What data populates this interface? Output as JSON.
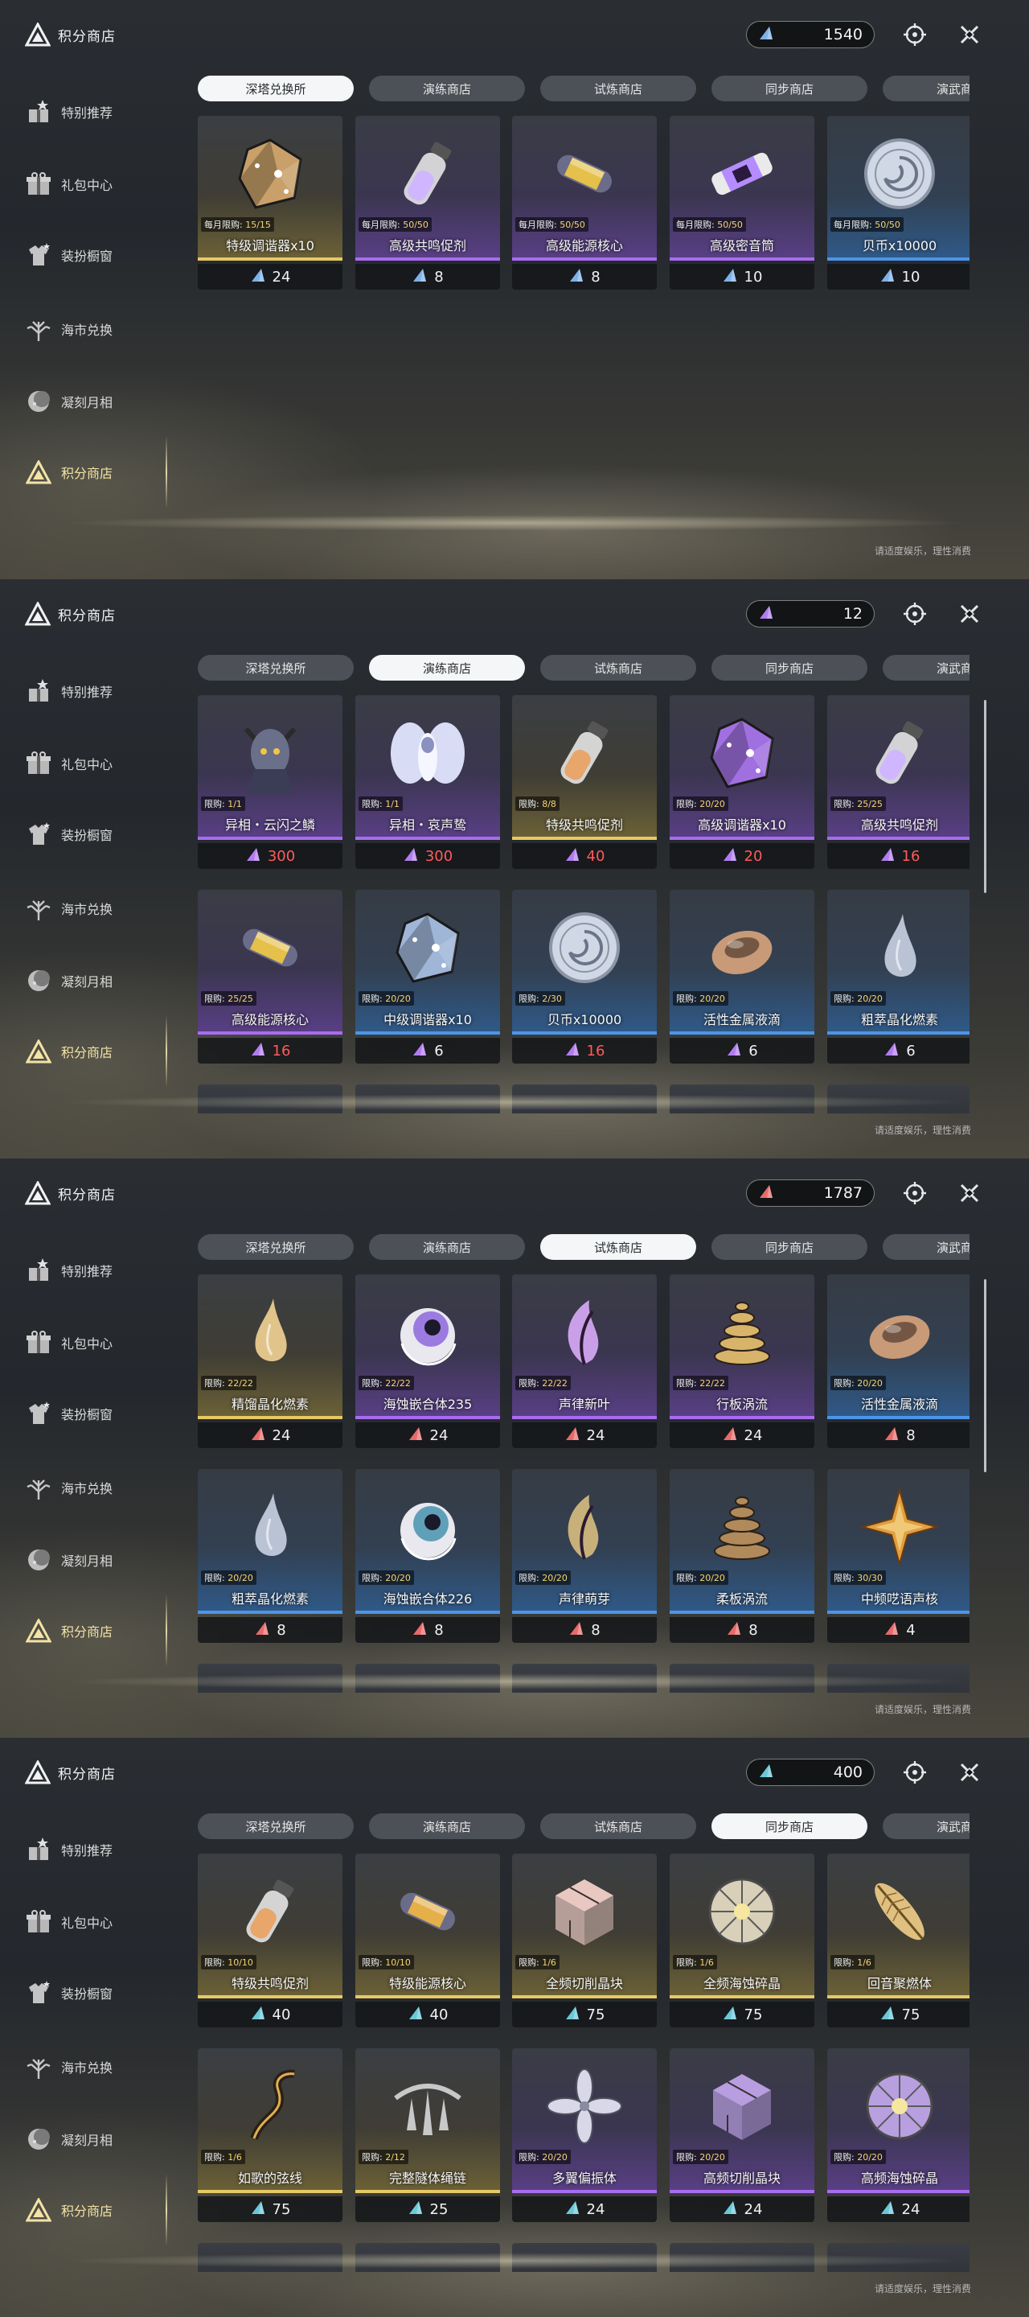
{
  "brand": {
    "title": "积分商店"
  },
  "sidebar": [
    {
      "label": "特别推荐",
      "icon": "gift-star-icon"
    },
    {
      "label": "礼包中心",
      "icon": "gift-box-icon"
    },
    {
      "label": "装扮橱窗",
      "icon": "wardrobe-icon"
    },
    {
      "label": "海市兑换",
      "icon": "tree-icon"
    },
    {
      "label": "凝刻月相",
      "icon": "moon-icon"
    },
    {
      "label": "积分商店",
      "icon": "triangle-shop-icon"
    }
  ],
  "tabs": [
    "深塔兑换所",
    "演练商店",
    "试炼商店",
    "同步商店",
    "演武商店"
  ],
  "notice": "请适度娱乐，理性消费",
  "colors": {
    "gold": "#e6c866",
    "purple": "#a86cf0",
    "blue": "#4c95e8",
    "price_red": "#ff5b5b"
  },
  "screens": [
    {
      "active_tab": 0,
      "currency": {
        "amount": "1540",
        "color": "#7fb0e8"
      },
      "scroll": false,
      "items": [
        {
          "name": "特级调谐器x10",
          "limit_label": "每月限购:",
          "limit": "15/15",
          "price": "24",
          "rarity": "gold",
          "art": "gem",
          "art_color": "#c9a06a"
        },
        {
          "name": "高级共鸣促剂",
          "limit_label": "每月限购:",
          "limit": "50/50",
          "price": "8",
          "rarity": "purple",
          "art": "vial",
          "art_color": "#d0b6ff"
        },
        {
          "name": "高级能源核心",
          "limit_label": "每月限购:",
          "limit": "50/50",
          "price": "8",
          "rarity": "purple",
          "art": "capsule",
          "art_color": "#e5c04a"
        },
        {
          "name": "高级密音筒",
          "limit_label": "每月限购:",
          "limit": "50/50",
          "price": "10",
          "rarity": "purple",
          "art": "cylinder",
          "art_color": "#b58cff"
        },
        {
          "name": "贝币x10000",
          "limit_label": "每月限购:",
          "limit": "50/50",
          "price": "10",
          "rarity": "blue",
          "art": "coin",
          "art_color": "#cfd8e4"
        }
      ]
    },
    {
      "active_tab": 1,
      "currency": {
        "amount": "12",
        "color": "#b27cf0"
      },
      "scroll": true,
      "items": [
        {
          "name": "异相・云闪之鳞",
          "limit_label": "限购:",
          "limit": "1/1",
          "price": "300",
          "rarity": "purple",
          "art": "figure",
          "art_color": "#6a6f8a",
          "red": true
        },
        {
          "name": "异相・哀声鸷",
          "limit_label": "限购:",
          "limit": "1/1",
          "price": "300",
          "rarity": "purple",
          "art": "wings",
          "art_color": "#d8dcf5",
          "red": true
        },
        {
          "name": "特级共鸣促剂",
          "limit_label": "限购:",
          "limit": "8/8",
          "price": "40",
          "rarity": "gold",
          "art": "vial",
          "art_color": "#e8a66a",
          "red": true
        },
        {
          "name": "高级调谐器x10",
          "limit_label": "限购:",
          "limit": "20/20",
          "price": "20",
          "rarity": "purple",
          "art": "gem",
          "art_color": "#a070e0",
          "red": true
        },
        {
          "name": "高级共鸣促剂",
          "limit_label": "限购:",
          "limit": "25/25",
          "price": "16",
          "rarity": "purple",
          "art": "vial",
          "art_color": "#d0b6ff",
          "red": true
        },
        {
          "name": "高级能源核心",
          "limit_label": "限购:",
          "limit": "25/25",
          "price": "16",
          "rarity": "purple",
          "art": "capsule",
          "art_color": "#e5c04a",
          "red": true
        },
        {
          "name": "中级调谐器x10",
          "limit_label": "限购:",
          "limit": "20/20",
          "price": "6",
          "rarity": "blue",
          "art": "gem",
          "art_color": "#9fb6d8"
        },
        {
          "name": "贝币x10000",
          "limit_label": "限购:",
          "limit": "2/30",
          "price": "16",
          "rarity": "blue",
          "art": "coin",
          "art_color": "#cfd8e4",
          "red": true
        },
        {
          "name": "活性金属液滴",
          "limit_label": "限购:",
          "limit": "20/20",
          "price": "6",
          "rarity": "blue",
          "art": "shell",
          "art_color": "#c89a78"
        },
        {
          "name": "粗萃晶化燃素",
          "limit_label": "限购:",
          "limit": "20/20",
          "price": "6",
          "rarity": "blue",
          "art": "drop",
          "art_color": "#b9c3d4"
        }
      ]
    },
    {
      "active_tab": 2,
      "currency": {
        "amount": "1787",
        "color": "#e86a6a"
      },
      "scroll": true,
      "items": [
        {
          "name": "精馏晶化燃素",
          "limit_label": "限购:",
          "limit": "22/22",
          "price": "24",
          "rarity": "gold",
          "art": "drop",
          "art_color": "#e0c48a"
        },
        {
          "name": "海蚀嵌合体235",
          "limit_label": "限购:",
          "limit": "22/22",
          "price": "24",
          "rarity": "purple",
          "art": "orb",
          "art_color": "#9b7be0"
        },
        {
          "name": "声律新叶",
          "limit_label": "限购:",
          "limit": "22/22",
          "price": "24",
          "rarity": "purple",
          "art": "leaf",
          "art_color": "#c9a0e8"
        },
        {
          "name": "行板涡流",
          "limit_label": "限购:",
          "limit": "22/22",
          "price": "24",
          "rarity": "purple",
          "art": "spiral",
          "art_color": "#d8b46a"
        },
        {
          "name": "活性金属液滴",
          "limit_label": "限购:",
          "limit": "20/20",
          "price": "8",
          "rarity": "blue",
          "art": "shell",
          "art_color": "#c89a78"
        },
        {
          "name": "粗萃晶化燃素",
          "limit_label": "限购:",
          "limit": "20/20",
          "price": "8",
          "rarity": "blue",
          "art": "drop",
          "art_color": "#b9c3d4"
        },
        {
          "name": "海蚀嵌合体226",
          "limit_label": "限购:",
          "limit": "20/20",
          "price": "8",
          "rarity": "blue",
          "art": "orb",
          "art_color": "#5fa0b8"
        },
        {
          "name": "声律萌芽",
          "limit_label": "限购:",
          "limit": "20/20",
          "price": "8",
          "rarity": "blue",
          "art": "leaf",
          "art_color": "#c8b07a"
        },
        {
          "name": "柔板涡流",
          "limit_label": "限购:",
          "limit": "20/20",
          "price": "8",
          "rarity": "blue",
          "art": "spiral",
          "art_color": "#b08a5a"
        },
        {
          "name": "中频呓语声核",
          "limit_label": "限购:",
          "limit": "30/30",
          "price": "4",
          "rarity": "blue",
          "art": "star",
          "art_color": "#e0a040"
        }
      ]
    },
    {
      "active_tab": 3,
      "currency": {
        "amount": "400",
        "color": "#6ac8d8"
      },
      "scroll": false,
      "items": [
        {
          "name": "特级共鸣促剂",
          "limit_label": "限购:",
          "limit": "10/10",
          "price": "40",
          "rarity": "gold",
          "art": "vial",
          "art_color": "#e8a66a"
        },
        {
          "name": "特级能源核心",
          "limit_label": "限购:",
          "limit": "10/10",
          "price": "40",
          "rarity": "gold",
          "art": "capsule",
          "art_color": "#e5b04a"
        },
        {
          "name": "全频切削晶块",
          "limit_label": "限购:",
          "limit": "1/6",
          "price": "75",
          "rarity": "gold",
          "art": "cube",
          "art_color": "#e8c8c0"
        },
        {
          "name": "全频海蚀碎晶",
          "limit_label": "限购:",
          "limit": "1/6",
          "price": "75",
          "rarity": "gold",
          "art": "disc",
          "art_color": "#d8d0b8"
        },
        {
          "name": "回音聚燃体",
          "limit_label": "限购:",
          "limit": "1/6",
          "price": "75",
          "rarity": "gold",
          "art": "feather",
          "art_color": "#e0c080"
        },
        {
          "name": "如歌的弦线",
          "limit_label": "限购:",
          "limit": "1/6",
          "price": "75",
          "rarity": "gold",
          "art": "string",
          "art_color": "#e0b050"
        },
        {
          "name": "完整隧体绳链",
          "limit_label": "限购:",
          "limit": "2/12",
          "price": "25",
          "rarity": "gold",
          "art": "chain",
          "art_color": "#c8c8c8"
        },
        {
          "name": "多翼偏振体",
          "limit_label": "限购:",
          "limit": "20/20",
          "price": "24",
          "rarity": "purple",
          "art": "flower",
          "art_color": "#d8d8e8"
        },
        {
          "name": "高频切削晶块",
          "limit_label": "限购:",
          "limit": "20/20",
          "price": "24",
          "rarity": "purple",
          "art": "cube",
          "art_color": "#b89ee0"
        },
        {
          "name": "高频海蚀碎晶",
          "limit_label": "限购:",
          "limit": "20/20",
          "price": "24",
          "rarity": "purple",
          "art": "disc",
          "art_color": "#b8a0e0"
        }
      ]
    }
  ]
}
